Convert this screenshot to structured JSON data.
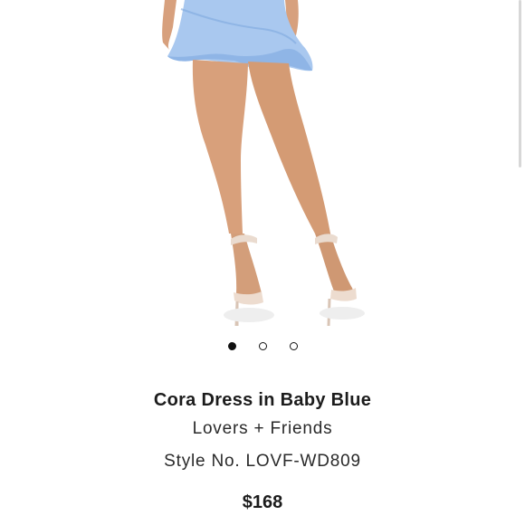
{
  "carousel": {
    "dot_count": 3,
    "active_index": 0
  },
  "product": {
    "name": "Cora Dress in Baby Blue",
    "brand": "Lovers + Friends",
    "style_number": "Style No. LOVF-WD809",
    "price": "$168"
  },
  "colors": {
    "dress": "#a9c8ef",
    "skin": "#d8a07b",
    "heel": "#eddccf",
    "text": "#1c1c1c"
  }
}
